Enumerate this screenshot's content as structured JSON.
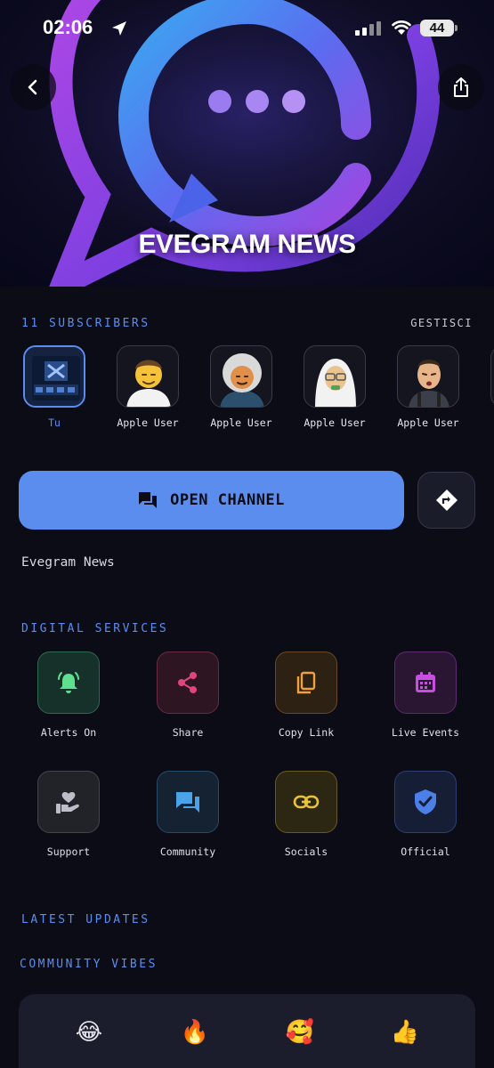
{
  "status_bar": {
    "time": "02:06",
    "battery": "44"
  },
  "hero": {
    "title": "EVEGRAM NEWS"
  },
  "subscribers": {
    "count_label": "11 SUBSCRIBERS",
    "manage_label": "GESTISCI",
    "items": [
      {
        "name": "Tu"
      },
      {
        "name": "Apple User"
      },
      {
        "name": "Apple User"
      },
      {
        "name": "Apple User"
      },
      {
        "name": "Apple User"
      }
    ]
  },
  "actions": {
    "open_channel": "OPEN CHANNEL"
  },
  "channel": {
    "description": "Evegram News"
  },
  "services": {
    "title": "DIGITAL SERVICES",
    "items": [
      {
        "label": "Alerts On",
        "icon": "bell-icon",
        "color": "#5ee08f"
      },
      {
        "label": "Share",
        "icon": "share-icon",
        "color": "#e0457b"
      },
      {
        "label": "Copy Link",
        "icon": "copy-icon",
        "color": "#f0a040"
      },
      {
        "label": "Live Events",
        "icon": "calendar-icon",
        "color": "#c64fe0"
      },
      {
        "label": "Support",
        "icon": "support-icon",
        "color": "#bdbdc8"
      },
      {
        "label": "Community",
        "icon": "chat-icon",
        "color": "#4aa3e8"
      },
      {
        "label": "Socials",
        "icon": "link-icon",
        "color": "#e8c23a"
      },
      {
        "label": "Official",
        "icon": "shield-check-icon",
        "color": "#4d7fe8"
      }
    ]
  },
  "latest_updates": {
    "title": "LATEST UPDATES"
  },
  "community_vibes": {
    "title": "COMMUNITY VIBES",
    "reactions": [
      {
        "emoji": "😂"
      },
      {
        "emoji": "🔥"
      },
      {
        "emoji": "🥰"
      },
      {
        "emoji": "👍"
      }
    ]
  }
}
